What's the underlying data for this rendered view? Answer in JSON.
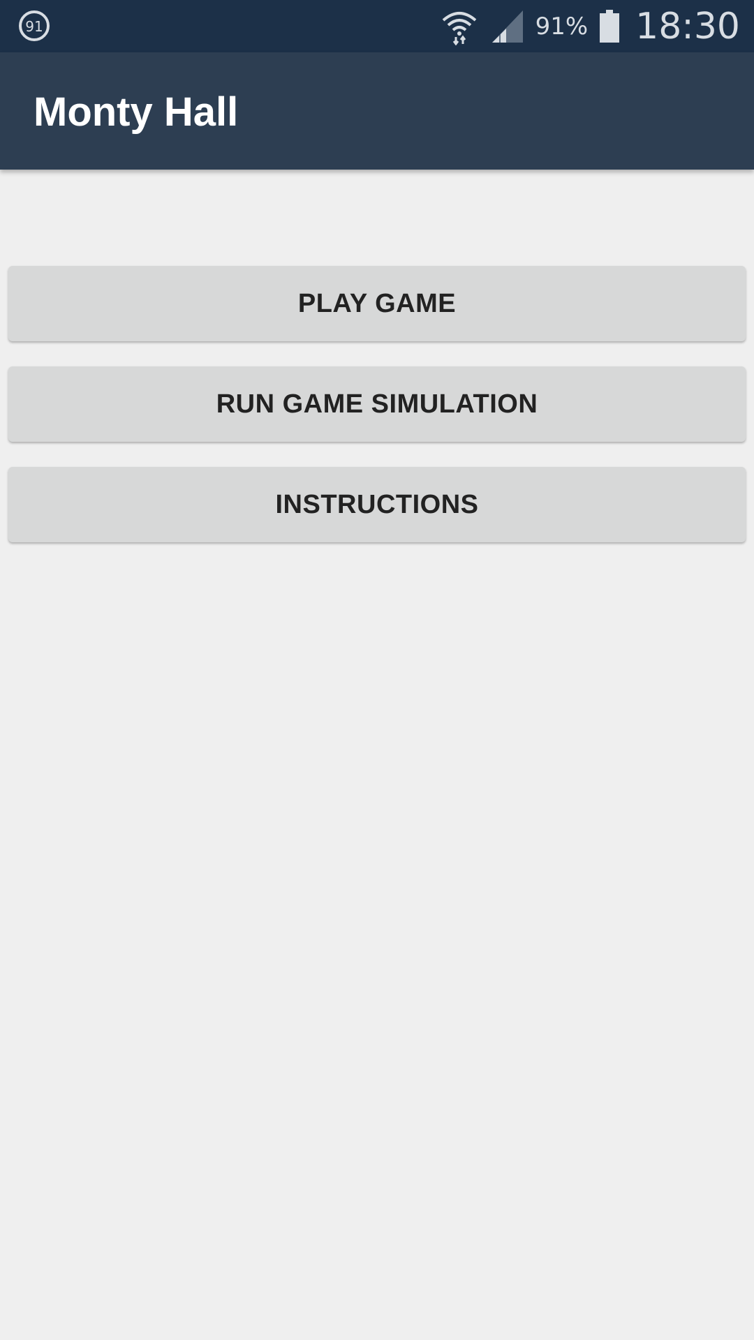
{
  "status_bar": {
    "notification_badge": "91",
    "battery_percent": "91%",
    "time": "18:30",
    "icons": [
      "notification-counter-icon",
      "wifi-icon",
      "cell-signal-icon",
      "battery-icon"
    ]
  },
  "app_bar": {
    "title": "Monty Hall"
  },
  "menu": {
    "play_label": "PLAY GAME",
    "simulation_label": "RUN GAME SIMULATION",
    "instructions_label": "INSTRUCTIONS"
  },
  "colors": {
    "status_bar_bg": "#1c3048",
    "app_bar_bg": "#2d3e52",
    "page_bg": "#efefef",
    "button_bg": "#d7d8d8",
    "button_text": "#222222"
  }
}
